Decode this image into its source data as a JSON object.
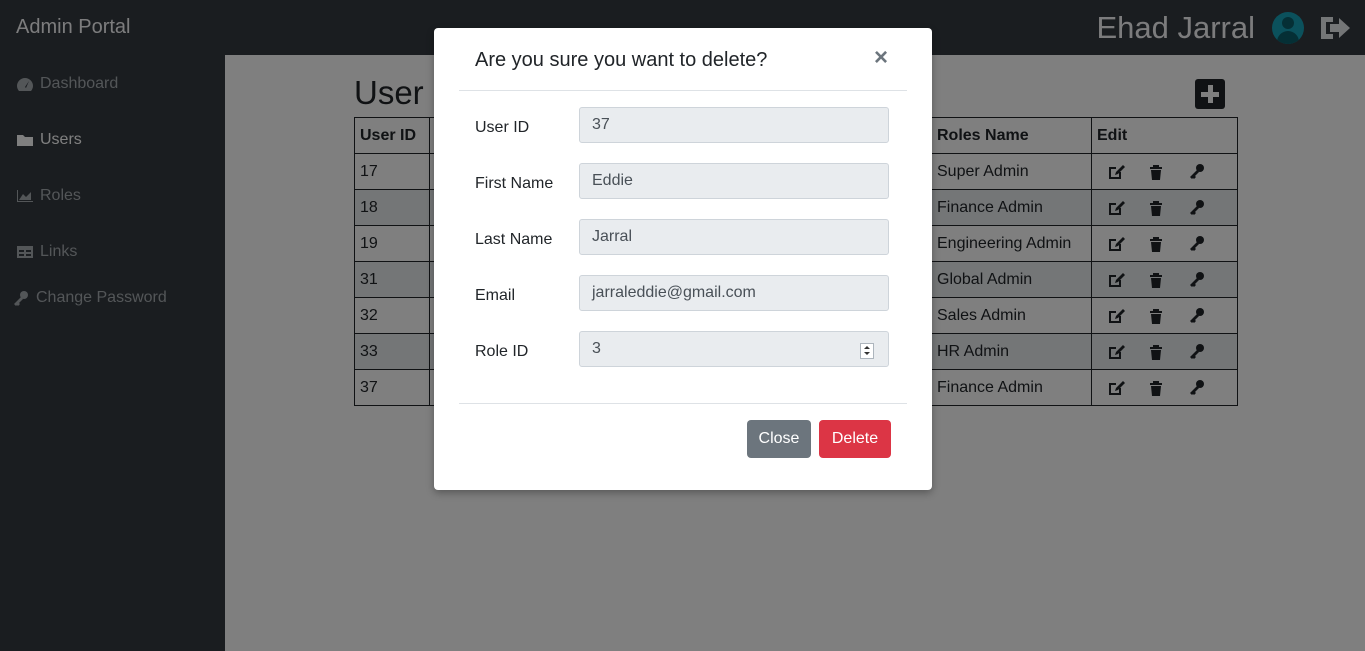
{
  "navbar": {
    "brand": "Admin Portal",
    "user_name": "Ehad Jarral",
    "avatar_icon": "user-circle-icon",
    "logout_icon": "sign-out-icon"
  },
  "sidebar": {
    "items": [
      {
        "label": "Dashboard",
        "icon": "tachometer-icon"
      },
      {
        "label": "Users",
        "icon": "folder-icon"
      },
      {
        "label": "Roles",
        "icon": "area-chart-icon"
      },
      {
        "label": "Links",
        "icon": "table-icon"
      },
      {
        "label": "Change Password",
        "icon": "key-icon"
      }
    ],
    "active": "Users"
  },
  "main": {
    "title": "User D",
    "add_icon": "plus-square-icon",
    "table": {
      "headers": [
        "User ID",
        "Roles Name",
        "Edit"
      ],
      "rows": [
        {
          "id": "17",
          "role": "Super Admin"
        },
        {
          "id": "18",
          "role": "Finance Admin"
        },
        {
          "id": "19",
          "role": "Engineering Admin"
        },
        {
          "id": "31",
          "role": "Global Admin"
        },
        {
          "id": "32",
          "role": "Sales Admin"
        },
        {
          "id": "33",
          "role": "HR Admin"
        },
        {
          "id": "37",
          "role": "Finance Admin"
        }
      ],
      "row_icons": [
        "edit-icon",
        "trash-icon",
        "key-icon"
      ]
    }
  },
  "modal": {
    "title": "Are you sure you want to delete?",
    "close_symbol": "×",
    "fields": [
      {
        "label": "User ID",
        "value": "37"
      },
      {
        "label": "First Name",
        "value": "Eddie"
      },
      {
        "label": "Last Name",
        "value": "Jarral"
      },
      {
        "label": "Email",
        "value": "jarraleddie@gmail.com"
      },
      {
        "label": "Role ID",
        "value": "3"
      }
    ],
    "close_button": "Close",
    "delete_button": "Delete"
  },
  "colors": {
    "navbar": "#343a40",
    "danger": "#dc3545",
    "secondary": "#6c757d",
    "field_bg": "#e9ecef"
  }
}
